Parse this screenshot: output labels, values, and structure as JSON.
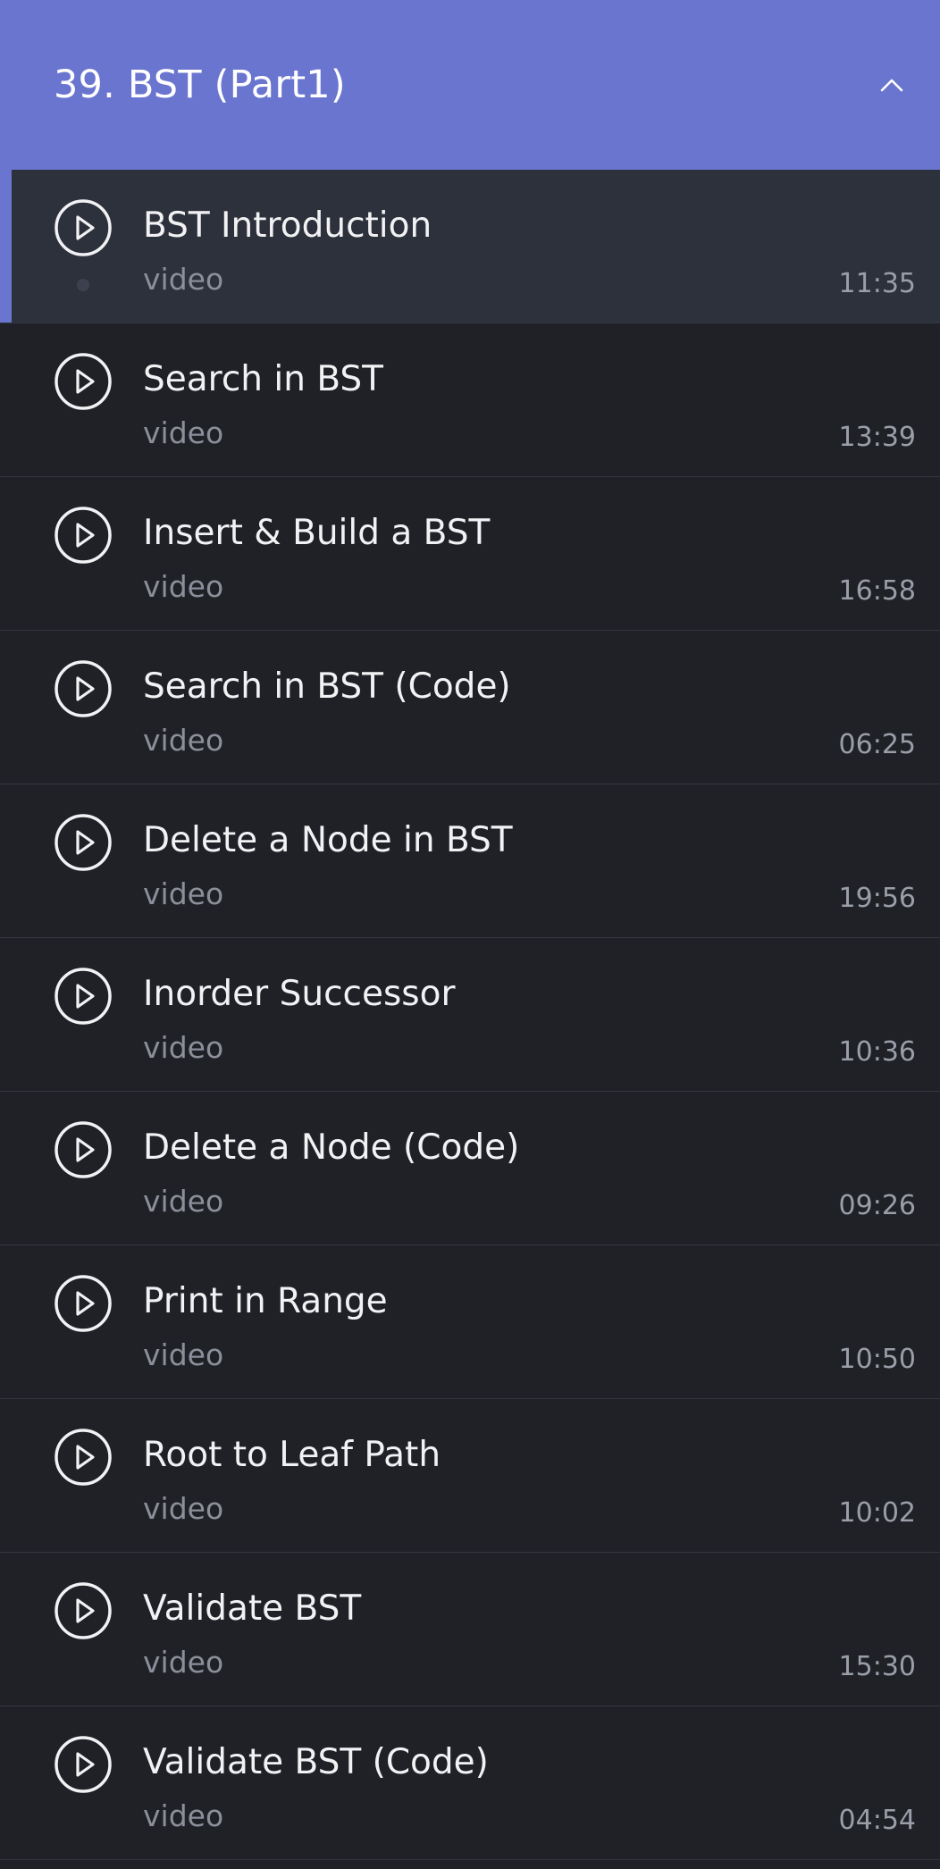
{
  "section": {
    "title": "39. BST (Part1)",
    "collapse_icon": "chevron-up-icon"
  },
  "colors": {
    "accent": "#6a75cf",
    "background": "#1f2127",
    "active_row": "#2d313b"
  },
  "lessons": [
    {
      "title": "BST Introduction",
      "type": "video",
      "duration": "11:35",
      "active": true
    },
    {
      "title": "Search in BST",
      "type": "video",
      "duration": "13:39"
    },
    {
      "title": "Insert & Build a BST",
      "type": "video",
      "duration": "16:58"
    },
    {
      "title": "Search in BST (Code)",
      "type": "video",
      "duration": "06:25"
    },
    {
      "title": "Delete a Node in BST",
      "type": "video",
      "duration": "19:56"
    },
    {
      "title": "Inorder Successor",
      "type": "video",
      "duration": "10:36"
    },
    {
      "title": "Delete a Node (Code)",
      "type": "video",
      "duration": "09:26"
    },
    {
      "title": "Print in Range",
      "type": "video",
      "duration": "10:50"
    },
    {
      "title": "Root to Leaf Path",
      "type": "video",
      "duration": "10:02"
    },
    {
      "title": "Validate BST",
      "type": "video",
      "duration": "15:30"
    },
    {
      "title": "Validate BST (Code)",
      "type": "video",
      "duration": "04:54"
    }
  ]
}
